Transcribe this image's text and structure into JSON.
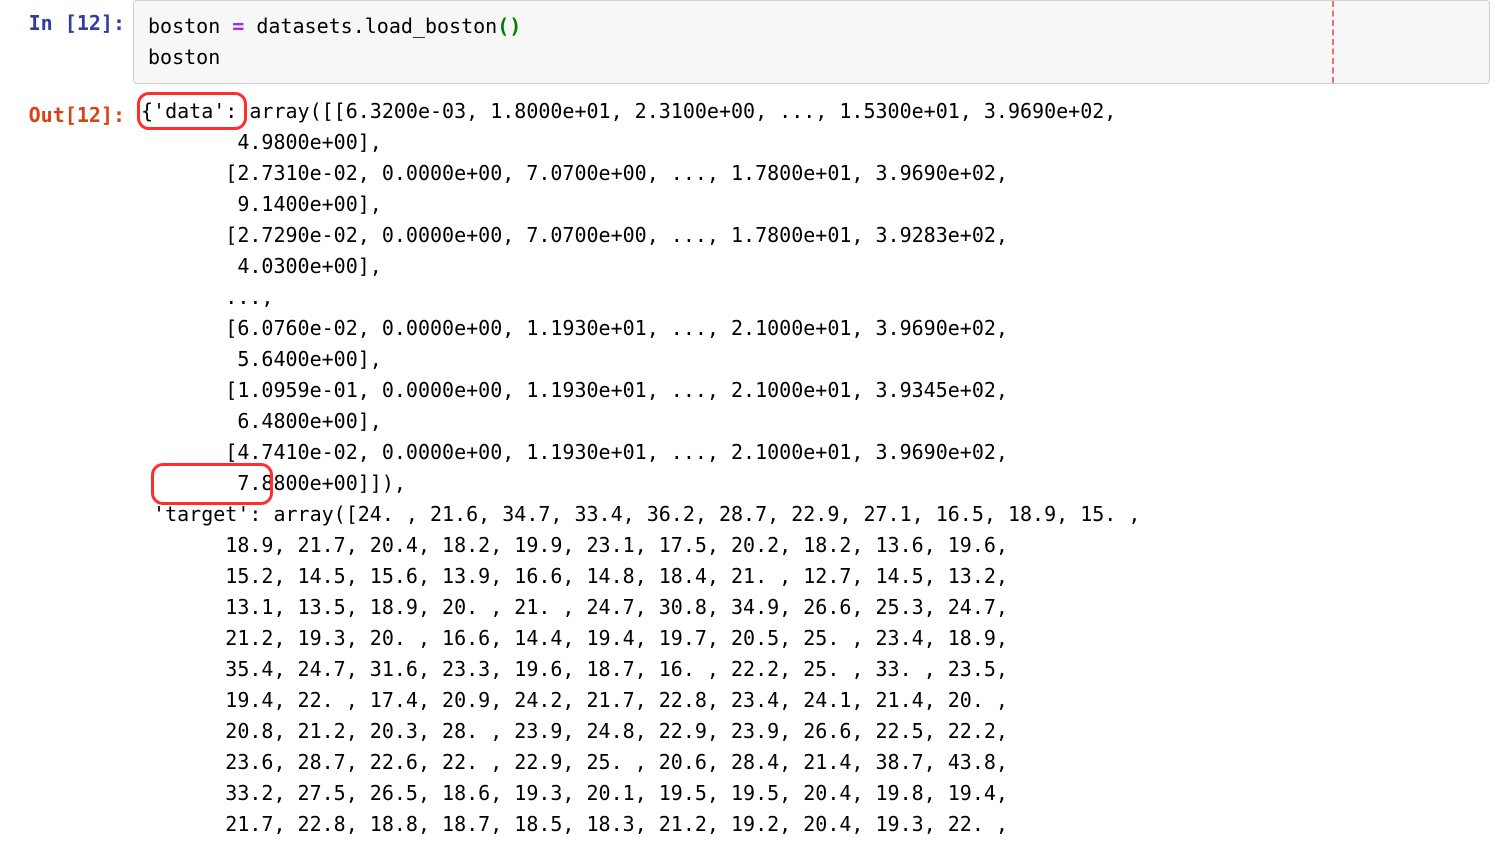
{
  "cell": {
    "exec_count": 12,
    "in_prompt_open": "In [",
    "out_prompt_open": "Out[",
    "prompt_close": "]:",
    "code": {
      "line1": {
        "lhs": "boston",
        "assignOp": " = ",
        "rhs": "datasets.load_boston",
        "parenOpen": "(",
        "parenClose": ")"
      },
      "line2": "boston"
    },
    "output_lines": [
      "{'data': array([[6.3200e-03, 1.8000e+01, 2.3100e+00, ..., 1.5300e+01, 3.9690e+02,",
      "        4.9800e+00],",
      "       [2.7310e-02, 0.0000e+00, 7.0700e+00, ..., 1.7800e+01, 3.9690e+02,",
      "        9.1400e+00],",
      "       [2.7290e-02, 0.0000e+00, 7.0700e+00, ..., 1.7800e+01, 3.9283e+02,",
      "        4.0300e+00],",
      "       ...,",
      "       [6.0760e-02, 0.0000e+00, 1.1930e+01, ..., 2.1000e+01, 3.9690e+02,",
      "        5.6400e+00],",
      "       [1.0959e-01, 0.0000e+00, 1.1930e+01, ..., 2.1000e+01, 3.9345e+02,",
      "        6.4800e+00],",
      "       [4.7410e-02, 0.0000e+00, 1.1930e+01, ..., 2.1000e+01, 3.9690e+02,",
      "        7.8800e+00]]),",
      " 'target': array([24. , 21.6, 34.7, 33.4, 36.2, 28.7, 22.9, 27.1, 16.5, 18.9, 15. ,",
      "       18.9, 21.7, 20.4, 18.2, 19.9, 23.1, 17.5, 20.2, 18.2, 13.6, 19.6,",
      "       15.2, 14.5, 15.6, 13.9, 16.6, 14.8, 18.4, 21. , 12.7, 14.5, 13.2,",
      "       13.1, 13.5, 18.9, 20. , 21. , 24.7, 30.8, 34.9, 26.6, 25.3, 24.7,",
      "       21.2, 19.3, 20. , 16.6, 14.4, 19.4, 19.7, 20.5, 25. , 23.4, 18.9,",
      "       35.4, 24.7, 31.6, 23.3, 19.6, 18.7, 16. , 22.2, 25. , 33. , 23.5,",
      "       19.4, 22. , 17.4, 20.9, 24.2, 21.7, 22.8, 23.4, 24.1, 21.4, 20. ,",
      "       20.8, 21.2, 20.3, 28. , 23.9, 24.8, 22.9, 23.9, 26.6, 22.5, 22.2,",
      "       23.6, 28.7, 22.6, 22. , 22.9, 25. , 20.6, 28.4, 21.4, 38.7, 43.8,",
      "       33.2, 27.5, 26.5, 18.6, 19.3, 20.1, 19.5, 19.5, 20.4, 19.8, 19.4,",
      "       21.7, 22.8, 18.8, 18.7, 18.5, 18.3, 21.2, 19.2, 20.4, 19.3, 22. ,"
    ]
  },
  "annotations": {
    "data_key_box": {
      "key_word": "'data'"
    },
    "target_key_box": {
      "key_word": "'target'"
    }
  }
}
